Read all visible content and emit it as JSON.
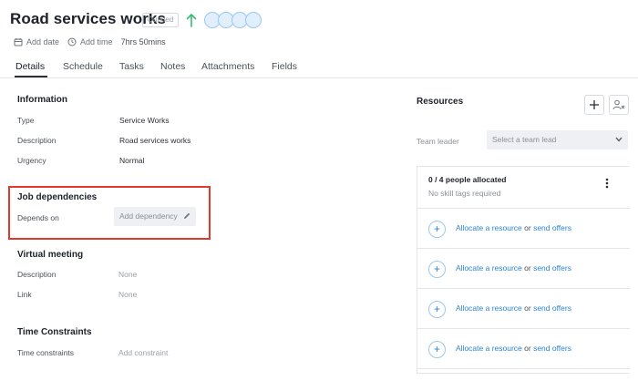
{
  "header": {
    "title": "Road services works",
    "status": "Queued",
    "add_date": "Add date",
    "add_time": "Add time",
    "duration": "7hrs 50mins",
    "avatar_count": 4,
    "accent_color": "#2fbf71"
  },
  "tabs": [
    "Details",
    "Schedule",
    "Tasks",
    "Notes",
    "Attachments",
    "Fields"
  ],
  "information": {
    "title": "Information",
    "rows": [
      {
        "label": "Type",
        "value": "Service Works"
      },
      {
        "label": "Description",
        "value": "Road services works"
      },
      {
        "label": "Urgency",
        "value": "Normal"
      }
    ]
  },
  "job_dependencies": {
    "title": "Job dependencies",
    "label": "Depends on",
    "button": "Add dependency",
    "highlight_color": "#e0392f"
  },
  "virtual_meeting": {
    "title": "Virtual meeting",
    "rows": [
      {
        "label": "Description",
        "value": "None"
      },
      {
        "label": "Link",
        "value": "None"
      }
    ]
  },
  "time_constraints": {
    "title": "Time Constraints",
    "label": "Time constraints",
    "value": "Add constraint"
  },
  "resources": {
    "title": "Resources",
    "team_leader_label": "Team leader",
    "team_leader_placeholder": "Select a team lead",
    "allocated": "0 / 4 people allocated",
    "skill_tags": "No skill tags required",
    "rows": [
      {
        "allocate": "Allocate a resource",
        "or": "or",
        "offers": "send offers"
      },
      {
        "allocate": "Allocate a resource",
        "or": "or",
        "offers": "send offers"
      },
      {
        "allocate": "Allocate a resource",
        "or": "or",
        "offers": "send offers"
      },
      {
        "allocate": "Allocate a resource",
        "or": "or",
        "offers": "send offers"
      }
    ],
    "link_color": "#2a84d2"
  }
}
